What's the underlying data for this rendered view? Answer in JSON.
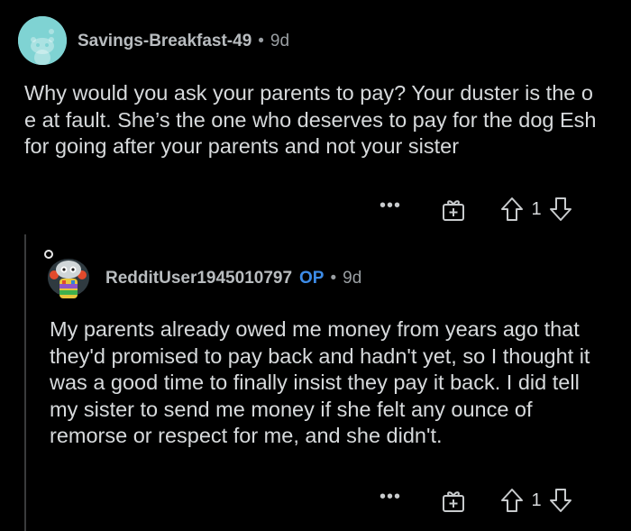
{
  "comments": [
    {
      "username": "Savings-Breakfast-49",
      "separator": "•",
      "age": "9d",
      "body": "Why would you ask your parents to pay? Your duster is the o e at fault. She’s the one who deserves to pay for the dog   Esh for going after your parents and not your sister",
      "score": "1",
      "more_label": "•••",
      "avatar_color": "#7fd3d3"
    },
    {
      "username": "RedditUser1945010797",
      "op_badge": "OP",
      "separator": "•",
      "age": "9d",
      "body": "My parents already owed me money from years ago that they'd promised to pay back and hadn't yet, so I thought it was a good time to finally insist they pay it back. I did tell my sister to send me money if she felt any ounce of remorse or respect for me, and she didn't.",
      "score": "1",
      "more_label": "•••"
    }
  ],
  "colors": {
    "background": "#000000",
    "text": "#d7dadc",
    "meta": "#9a9fa3",
    "op_badge": "#3d8ce8",
    "thread_line": "#3a3b3c"
  },
  "icons": [
    "snoo-avatar-icon",
    "custom-avatar-icon",
    "more-options-icon",
    "award-icon",
    "upvote-icon",
    "downvote-icon"
  ]
}
